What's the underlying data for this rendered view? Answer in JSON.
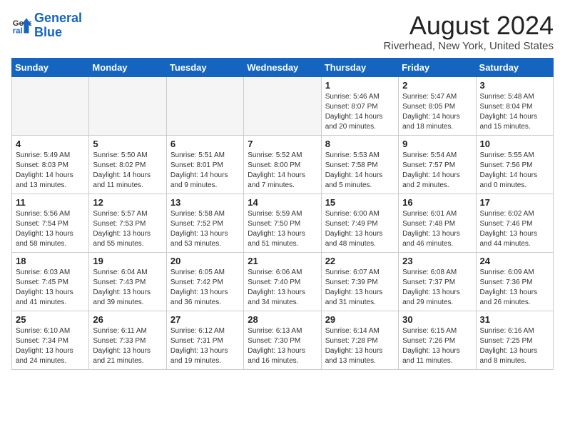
{
  "logo": {
    "line1": "General",
    "line2": "Blue"
  },
  "title": "August 2024",
  "location": "Riverhead, New York, United States",
  "weekdays": [
    "Sunday",
    "Monday",
    "Tuesday",
    "Wednesday",
    "Thursday",
    "Friday",
    "Saturday"
  ],
  "weeks": [
    [
      {
        "day": "",
        "empty": true
      },
      {
        "day": "",
        "empty": true
      },
      {
        "day": "",
        "empty": true
      },
      {
        "day": "",
        "empty": true
      },
      {
        "day": "1",
        "lines": [
          "Sunrise: 5:46 AM",
          "Sunset: 8:07 PM",
          "Daylight: 14 hours",
          "and 20 minutes."
        ]
      },
      {
        "day": "2",
        "lines": [
          "Sunrise: 5:47 AM",
          "Sunset: 8:05 PM",
          "Daylight: 14 hours",
          "and 18 minutes."
        ]
      },
      {
        "day": "3",
        "lines": [
          "Sunrise: 5:48 AM",
          "Sunset: 8:04 PM",
          "Daylight: 14 hours",
          "and 15 minutes."
        ]
      }
    ],
    [
      {
        "day": "4",
        "lines": [
          "Sunrise: 5:49 AM",
          "Sunset: 8:03 PM",
          "Daylight: 14 hours",
          "and 13 minutes."
        ]
      },
      {
        "day": "5",
        "lines": [
          "Sunrise: 5:50 AM",
          "Sunset: 8:02 PM",
          "Daylight: 14 hours",
          "and 11 minutes."
        ]
      },
      {
        "day": "6",
        "lines": [
          "Sunrise: 5:51 AM",
          "Sunset: 8:01 PM",
          "Daylight: 14 hours",
          "and 9 minutes."
        ]
      },
      {
        "day": "7",
        "lines": [
          "Sunrise: 5:52 AM",
          "Sunset: 8:00 PM",
          "Daylight: 14 hours",
          "and 7 minutes."
        ]
      },
      {
        "day": "8",
        "lines": [
          "Sunrise: 5:53 AM",
          "Sunset: 7:58 PM",
          "Daylight: 14 hours",
          "and 5 minutes."
        ]
      },
      {
        "day": "9",
        "lines": [
          "Sunrise: 5:54 AM",
          "Sunset: 7:57 PM",
          "Daylight: 14 hours",
          "and 2 minutes."
        ]
      },
      {
        "day": "10",
        "lines": [
          "Sunrise: 5:55 AM",
          "Sunset: 7:56 PM",
          "Daylight: 14 hours",
          "and 0 minutes."
        ]
      }
    ],
    [
      {
        "day": "11",
        "lines": [
          "Sunrise: 5:56 AM",
          "Sunset: 7:54 PM",
          "Daylight: 13 hours",
          "and 58 minutes."
        ]
      },
      {
        "day": "12",
        "lines": [
          "Sunrise: 5:57 AM",
          "Sunset: 7:53 PM",
          "Daylight: 13 hours",
          "and 55 minutes."
        ]
      },
      {
        "day": "13",
        "lines": [
          "Sunrise: 5:58 AM",
          "Sunset: 7:52 PM",
          "Daylight: 13 hours",
          "and 53 minutes."
        ]
      },
      {
        "day": "14",
        "lines": [
          "Sunrise: 5:59 AM",
          "Sunset: 7:50 PM",
          "Daylight: 13 hours",
          "and 51 minutes."
        ]
      },
      {
        "day": "15",
        "lines": [
          "Sunrise: 6:00 AM",
          "Sunset: 7:49 PM",
          "Daylight: 13 hours",
          "and 48 minutes."
        ]
      },
      {
        "day": "16",
        "lines": [
          "Sunrise: 6:01 AM",
          "Sunset: 7:48 PM",
          "Daylight: 13 hours",
          "and 46 minutes."
        ]
      },
      {
        "day": "17",
        "lines": [
          "Sunrise: 6:02 AM",
          "Sunset: 7:46 PM",
          "Daylight: 13 hours",
          "and 44 minutes."
        ]
      }
    ],
    [
      {
        "day": "18",
        "lines": [
          "Sunrise: 6:03 AM",
          "Sunset: 7:45 PM",
          "Daylight: 13 hours",
          "and 41 minutes."
        ]
      },
      {
        "day": "19",
        "lines": [
          "Sunrise: 6:04 AM",
          "Sunset: 7:43 PM",
          "Daylight: 13 hours",
          "and 39 minutes."
        ]
      },
      {
        "day": "20",
        "lines": [
          "Sunrise: 6:05 AM",
          "Sunset: 7:42 PM",
          "Daylight: 13 hours",
          "and 36 minutes."
        ]
      },
      {
        "day": "21",
        "lines": [
          "Sunrise: 6:06 AM",
          "Sunset: 7:40 PM",
          "Daylight: 13 hours",
          "and 34 minutes."
        ]
      },
      {
        "day": "22",
        "lines": [
          "Sunrise: 6:07 AM",
          "Sunset: 7:39 PM",
          "Daylight: 13 hours",
          "and 31 minutes."
        ]
      },
      {
        "day": "23",
        "lines": [
          "Sunrise: 6:08 AM",
          "Sunset: 7:37 PM",
          "Daylight: 13 hours",
          "and 29 minutes."
        ]
      },
      {
        "day": "24",
        "lines": [
          "Sunrise: 6:09 AM",
          "Sunset: 7:36 PM",
          "Daylight: 13 hours",
          "and 26 minutes."
        ]
      }
    ],
    [
      {
        "day": "25",
        "lines": [
          "Sunrise: 6:10 AM",
          "Sunset: 7:34 PM",
          "Daylight: 13 hours",
          "and 24 minutes."
        ]
      },
      {
        "day": "26",
        "lines": [
          "Sunrise: 6:11 AM",
          "Sunset: 7:33 PM",
          "Daylight: 13 hours",
          "and 21 minutes."
        ]
      },
      {
        "day": "27",
        "lines": [
          "Sunrise: 6:12 AM",
          "Sunset: 7:31 PM",
          "Daylight: 13 hours",
          "and 19 minutes."
        ]
      },
      {
        "day": "28",
        "lines": [
          "Sunrise: 6:13 AM",
          "Sunset: 7:30 PM",
          "Daylight: 13 hours",
          "and 16 minutes."
        ]
      },
      {
        "day": "29",
        "lines": [
          "Sunrise: 6:14 AM",
          "Sunset: 7:28 PM",
          "Daylight: 13 hours",
          "and 13 minutes."
        ]
      },
      {
        "day": "30",
        "lines": [
          "Sunrise: 6:15 AM",
          "Sunset: 7:26 PM",
          "Daylight: 13 hours",
          "and 11 minutes."
        ]
      },
      {
        "day": "31",
        "lines": [
          "Sunrise: 6:16 AM",
          "Sunset: 7:25 PM",
          "Daylight: 13 hours",
          "and 8 minutes."
        ]
      }
    ]
  ]
}
